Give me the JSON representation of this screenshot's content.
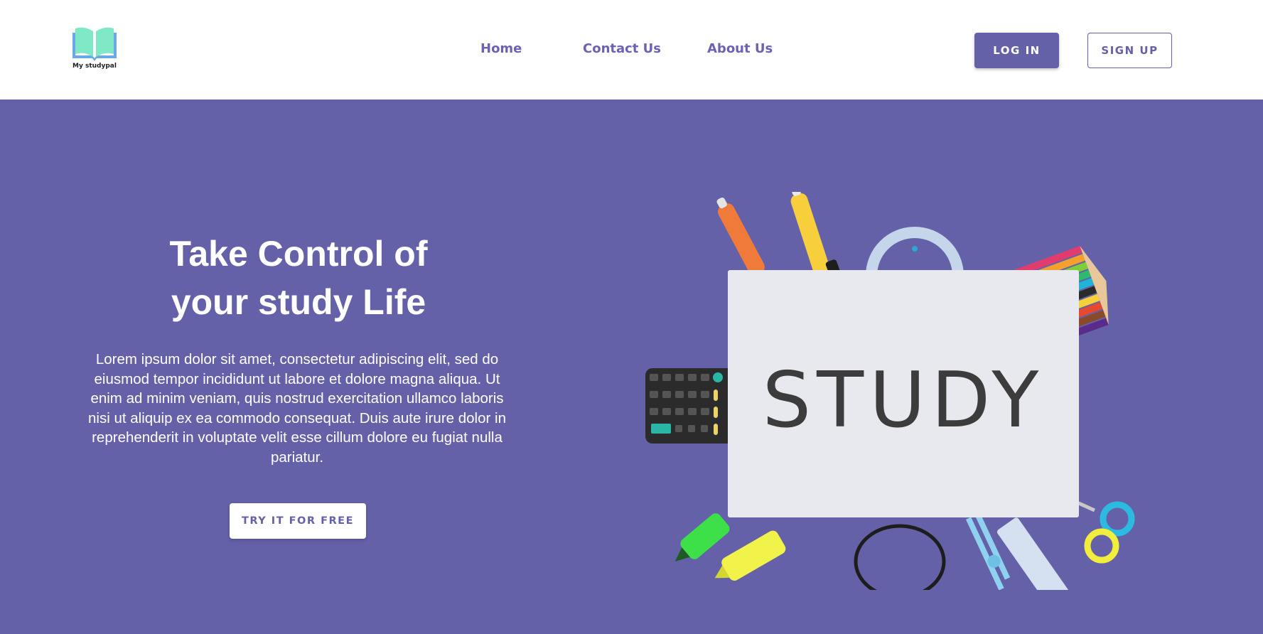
{
  "header": {
    "logo_text": "My studypal",
    "nav": [
      {
        "label": "Home"
      },
      {
        "label": "Contact Us"
      },
      {
        "label": "About Us"
      }
    ],
    "login_label": "LOG IN",
    "signup_label": "SIGN UP"
  },
  "hero": {
    "title_line1": "Take Control of",
    "title_line2": "your study Life",
    "body": "Lorem ipsum dolor sit amet, consectetur adipiscing elit, sed do eiusmod tempor incididunt ut labore et dolore magna aliqua. Ut enim ad minim veniam, quis nostrud exercitation ullamco laboris nisi ut aliquip ex ea commodo consequat. Duis aute irure dolor in reprehenderit in voluptate velit esse cillum dolore eu fugiat nulla pariatur.",
    "cta_label": "TRY IT FOR FREE",
    "image_word": "STUDY"
  },
  "colors": {
    "brand": "#6561a9",
    "nav_text": "#6c62b4",
    "logo_book": "#7fe8c6",
    "background": "#ffffff"
  },
  "icons": {
    "logo": "open-book-icon"
  }
}
